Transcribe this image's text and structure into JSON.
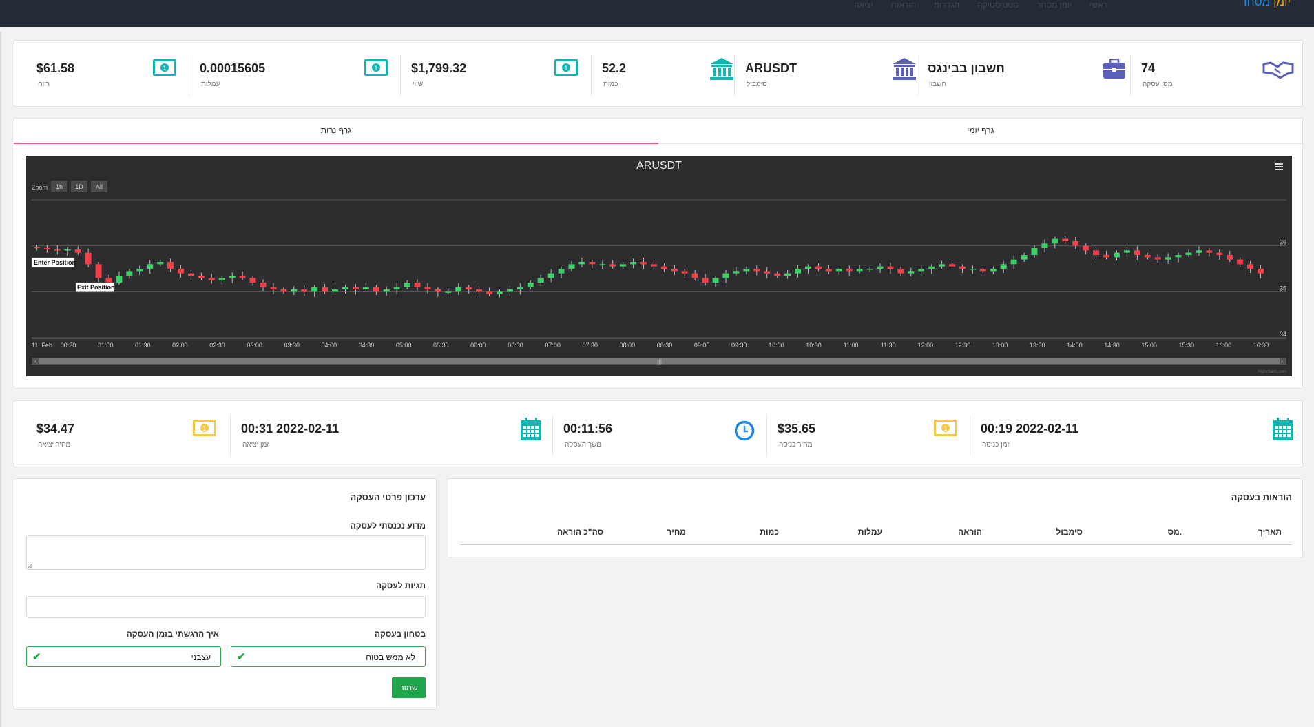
{
  "app": {
    "brand_part1": "יומן",
    "brand_part2": "מסחר",
    "nav": [
      "ראשי",
      "יומן מסחר",
      "סטטיסטיקה",
      "הגדרות",
      "הוראות",
      "יציאה"
    ]
  },
  "stats_top": [
    {
      "value": "74",
      "label": "מס. עסקה",
      "icon": "handshake-icon"
    },
    {
      "value": "חשבון בבינגס",
      "label": "חשבון",
      "icon": "briefcase-icon"
    },
    {
      "value": "ARUSDT",
      "label": "סימבול",
      "icon": "bank-icon"
    },
    {
      "value": "52.2",
      "label": "כמות",
      "icon": "bank-icon"
    },
    {
      "value": "$1,799.32",
      "label": "שווי",
      "icon": "money-icon"
    },
    {
      "value": "0.00015605",
      "label": "עמלות",
      "icon": "money-icon"
    },
    {
      "value": "$61.58",
      "label": "רווח",
      "icon": "money-icon"
    }
  ],
  "tabs": {
    "daily": "גרף יומי",
    "candles": "גרף נרות"
  },
  "chart": {
    "title": "ARUSDT",
    "zoom_label": "Zoom",
    "zoom_buttons": [
      "1h",
      "1D",
      "All"
    ],
    "credits": "Highcharts.com",
    "enter_label": "Enter Position",
    "exit_label": "Exit Position",
    "x_start_label": "11. Feb"
  },
  "chart_data": {
    "type": "candlestick",
    "title": "ARUSDT",
    "x_ticks": [
      "11. Feb",
      "00:30",
      "01:00",
      "01:30",
      "02:00",
      "02:30",
      "03:00",
      "03:30",
      "04:00",
      "04:30",
      "05:00",
      "05:30",
      "06:00",
      "06:30",
      "07:00",
      "07:30",
      "08:00",
      "08:30",
      "09:00",
      "09:30",
      "10:00",
      "10:30",
      "11:00",
      "11:30",
      "12:00",
      "12:30",
      "13:00",
      "13:30",
      "14:00",
      "14:30",
      "15:00",
      "15:30",
      "16:00",
      "16:30"
    ],
    "y_ticks": [
      34,
      35,
      36
    ],
    "ylim": [
      34,
      37
    ],
    "close_series": [
      35.95,
      35.92,
      35.9,
      35.92,
      35.85,
      35.6,
      35.3,
      35.2,
      35.35,
      35.45,
      35.5,
      35.6,
      35.65,
      35.5,
      35.4,
      35.35,
      35.3,
      35.25,
      35.3,
      35.35,
      35.3,
      35.2,
      35.1,
      35.05,
      35.0,
      35.05,
      35.0,
      35.1,
      35.0,
      35.05,
      35.1,
      35.05,
      35.1,
      35.0,
      35.05,
      35.1,
      35.2,
      35.1,
      35.05,
      35.0,
      35.0,
      35.1,
      35.05,
      35.0,
      34.95,
      35.0,
      35.05,
      35.1,
      35.2,
      35.3,
      35.4,
      35.5,
      35.6,
      35.65,
      35.6,
      35.6,
      35.55,
      35.6,
      35.65,
      35.6,
      35.55,
      35.5,
      35.45,
      35.4,
      35.3,
      35.2,
      35.3,
      35.4,
      35.45,
      35.5,
      35.45,
      35.4,
      35.35,
      35.4,
      35.5,
      35.55,
      35.5,
      35.45,
      35.5,
      35.45,
      35.5,
      35.5,
      35.55,
      35.5,
      35.4,
      35.45,
      35.5,
      35.55,
      35.6,
      35.55,
      35.5,
      35.5,
      35.45,
      35.5,
      35.6,
      35.7,
      35.8,
      35.95,
      36.05,
      36.15,
      36.1,
      36.0,
      35.9,
      35.8,
      35.75,
      35.85,
      35.9,
      35.8,
      35.75,
      35.7,
      35.75,
      35.8,
      35.85,
      35.9,
      35.85,
      35.8,
      35.7,
      35.6,
      35.5,
      35.4
    ],
    "annotations": [
      "Enter Position",
      "Exit Position"
    ]
  },
  "stats_mid": [
    {
      "value": "2022-02-11 00:19",
      "label": "זמן כניסה",
      "icon": "calendar-icon"
    },
    {
      "value": "$35.65",
      "label": "מחיר כניסה",
      "icon": "money-icon"
    },
    {
      "value": "00:11:56",
      "label": "משך העסקה",
      "icon": "clock-icon"
    },
    {
      "value": "2022-02-11 00:31",
      "label": "זמן יציאה",
      "icon": "calendar-icon"
    },
    {
      "value": "$34.47",
      "label": "מחיר יציאה",
      "icon": "money-icon"
    }
  ],
  "orders": {
    "title": "הוראות בעסקה",
    "columns": [
      "תאריך",
      "מס.",
      "סימבול",
      "הוראה",
      "עמלות",
      "כמות",
      "מחיר",
      "סה\"כ הוראה"
    ]
  },
  "form": {
    "title": "עדכון פרטי העסקה",
    "why_label": "מדוע נכנסתי לעסקה",
    "tags_label": "תגיות לעסקה",
    "confidence_label": "בטחון בעסקה",
    "confidence_value": "לא ממש בטוח",
    "feeling_label": "איך הרגשתי בזמן העסקה",
    "feeling_value": "עצבני",
    "save": "שמור"
  },
  "colors": {
    "bull": "#3fcf68",
    "bear": "#f0414b",
    "accent_tab": "#e8577e",
    "icon_teal": "#12b5b0",
    "icon_purple": "#5c5fb8",
    "icon_yellow": "#f6c944",
    "save_green": "#1fa64a"
  }
}
